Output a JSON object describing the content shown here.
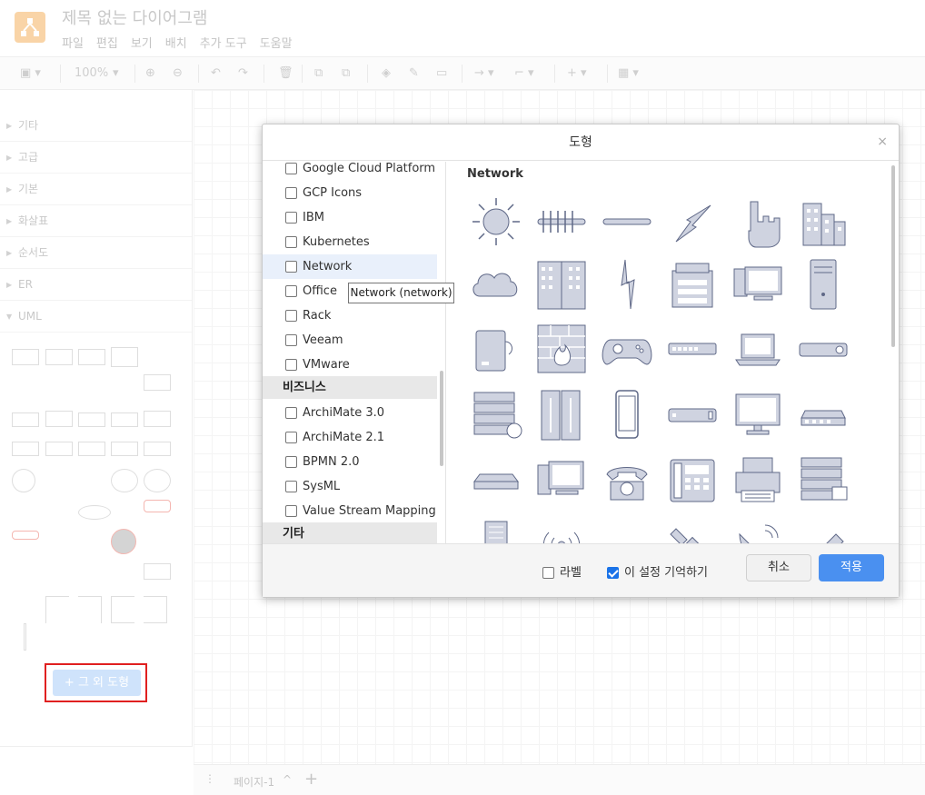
{
  "app": {
    "title": "제목 없는 다이어그램",
    "menu": [
      "파일",
      "편집",
      "보기",
      "배치",
      "추가 도구",
      "도움말"
    ]
  },
  "toolbar": {
    "zoom": "100%"
  },
  "sidebar": {
    "sections": [
      "기타",
      "고급",
      "기본",
      "화살표",
      "순서도",
      "ER",
      "UML"
    ],
    "more_shapes_label": "+ 그 외 도형"
  },
  "pagebar": {
    "page_label": "페이지-1",
    "add_page": "+"
  },
  "dialog": {
    "title": "도형",
    "close": "×",
    "libraries": [
      {
        "label": "Google Cloud Platform",
        "checked": false
      },
      {
        "label": "GCP Icons",
        "checked": false
      },
      {
        "label": "IBM",
        "checked": false
      },
      {
        "label": "Kubernetes",
        "checked": false
      },
      {
        "label": "Network",
        "checked": false
      },
      {
        "label": "Office",
        "checked": false
      },
      {
        "label": "Rack",
        "checked": false
      },
      {
        "label": "Veeam",
        "checked": false
      },
      {
        "label": "VMware",
        "checked": false
      }
    ],
    "group_business": "비즈니스",
    "business_libraries": [
      {
        "label": "ArchiMate 3.0",
        "checked": false
      },
      {
        "label": "ArchiMate 2.1",
        "checked": false
      },
      {
        "label": "BPMN 2.0",
        "checked": false
      },
      {
        "label": "SysML",
        "checked": false
      },
      {
        "label": "Value Stream Mapping",
        "checked": false
      }
    ],
    "group_other": "기타",
    "tooltip": "Network (network)",
    "preview_title": "Network",
    "icons": [
      "sun-icon",
      "comb-icon",
      "cable-icon",
      "lightning-icon",
      "touch-hand-icon",
      "buildings-icon",
      "cloud-icon",
      "office-tower-icon",
      "bolt-icon",
      "copier-icon",
      "pc-icon",
      "server-tower-icon",
      "external-drive-icon",
      "firewall-icon",
      "gamepad-icon",
      "switch-icon",
      "laptop-icon",
      "router-icon",
      "server-mail-icon",
      "mainframe-icon",
      "mobile-icon",
      "modem-icon",
      "monitor-icon",
      "nas-icon",
      "patch-panel-icon",
      "workstation-icon",
      "phone-icon",
      "ip-phone-icon",
      "printer-icon",
      "rack-server-icon",
      "server-icon",
      "wireless-icon",
      "ups-icon",
      "satellite-icon",
      "satellite-dish-icon",
      "antenna-icon"
    ],
    "footer": {
      "label_option": "라벨",
      "label_checked": false,
      "remember_option": "이 설정 기억하기",
      "remember_checked": true,
      "cancel": "취소",
      "apply": "적용"
    }
  },
  "colors": {
    "accent": "#4a90f0",
    "icon_fill": "#cfd3e0",
    "icon_stroke": "#5f6887",
    "highlight": "#e02020"
  }
}
